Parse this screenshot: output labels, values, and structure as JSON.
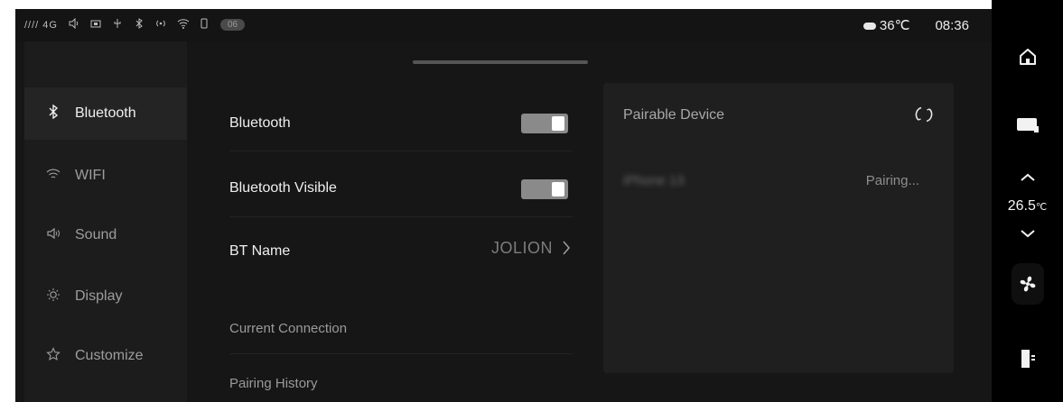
{
  "status_bar": {
    "signal_text": "//// 4G",
    "icons": [
      "volume-icon",
      "cast-icon",
      "usb-icon",
      "bluetooth-icon",
      "hotspot-icon",
      "wifi-icon",
      "phone-icon"
    ],
    "badge": "06",
    "weather_icon": "cloud-sun-icon",
    "temperature": "36℃",
    "time": "08:36"
  },
  "sidebar": {
    "items": [
      {
        "label": "Bluetooth",
        "icon": "bluetooth-icon",
        "active": true
      },
      {
        "label": "WIFI",
        "icon": "wifi-icon",
        "active": false
      },
      {
        "label": "Sound",
        "icon": "speaker-icon",
        "active": false
      },
      {
        "label": "Display",
        "icon": "brightness-icon",
        "active": false
      },
      {
        "label": "Customize",
        "icon": "star-icon",
        "active": false
      }
    ]
  },
  "settings": {
    "bluetooth": {
      "label": "Bluetooth",
      "on": true
    },
    "bluetooth_visible": {
      "label": "Bluetooth Visible",
      "on": true
    },
    "bt_name": {
      "label": "BT Name",
      "value": "JOLION"
    },
    "current_connection_label": "Current Connection",
    "pairing_history_label": "Pairing History"
  },
  "pairable": {
    "title": "Pairable Device",
    "refresh_icon": "refresh-icon",
    "devices": [
      {
        "name": "iPhone 13",
        "status": "Pairing..."
      }
    ]
  },
  "right_rail": {
    "icons": [
      "home-icon",
      "screen-icon",
      "chevron-up-icon",
      "chevron-down-icon",
      "fan-icon",
      "phone-door-icon"
    ],
    "temperature_value": "26.5",
    "temperature_unit": "℃"
  },
  "colors": {
    "background": "#161616",
    "sidebar": "#1c1c1c",
    "panel": "#1f1f1f",
    "toggle_on": "#8a8a8a",
    "rail": "#000000"
  }
}
